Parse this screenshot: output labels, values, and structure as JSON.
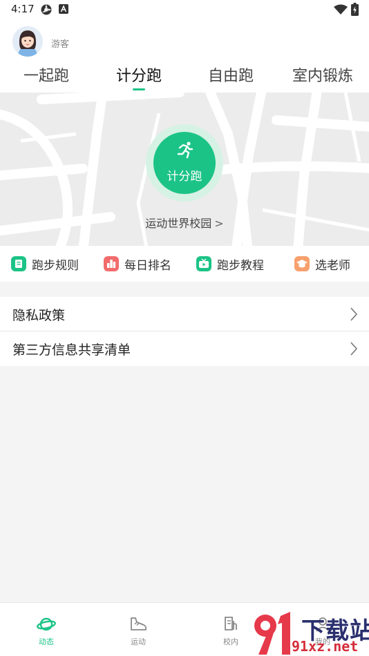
{
  "status_bar": {
    "time": "4:17",
    "icons": [
      "settings-gear-icon",
      "font-a-icon",
      "wifi-icon",
      "battery-charging-icon"
    ]
  },
  "user": {
    "name": "游客",
    "avatar_icon": "girl-avatar-icon"
  },
  "tabs": [
    {
      "label": "一起跑",
      "active": false
    },
    {
      "label": "计分跑",
      "active": true
    },
    {
      "label": "自由跑",
      "active": false
    },
    {
      "label": "室内锻炼",
      "active": false
    }
  ],
  "start_button": {
    "label": "计分跑",
    "icon": "running-person-icon"
  },
  "school": {
    "name": "运动世界校园",
    "chevron": ">"
  },
  "features": [
    {
      "label": "跑步规则",
      "icon": "clipboard-icon",
      "color": "#1cc387"
    },
    {
      "label": "每日排名",
      "icon": "ranking-icon",
      "color": "#f26b6b"
    },
    {
      "label": "跑步教程",
      "icon": "tv-play-icon",
      "color": "#1cc387"
    },
    {
      "label": "选老师",
      "icon": "graduation-cap-icon",
      "color": "#f7a06d"
    }
  ],
  "menu": [
    {
      "label": "隐私政策"
    },
    {
      "label": "第三方信息共享清单"
    }
  ],
  "bottom_nav": [
    {
      "label": "动态",
      "icon": "planet-icon",
      "active": true
    },
    {
      "label": "运动",
      "icon": "sneaker-icon",
      "active": false
    },
    {
      "label": "校内",
      "icon": "school-doc-icon",
      "active": false
    },
    {
      "label": "我的",
      "icon": "profile-icon",
      "active": false
    }
  ],
  "watermark": {
    "logo_text": "91",
    "title": "下载站",
    "domain": "91xz.net"
  },
  "colors": {
    "accent": "#1cc387",
    "accent_light": "#d6f2e5",
    "background": "#f4f4f4"
  }
}
